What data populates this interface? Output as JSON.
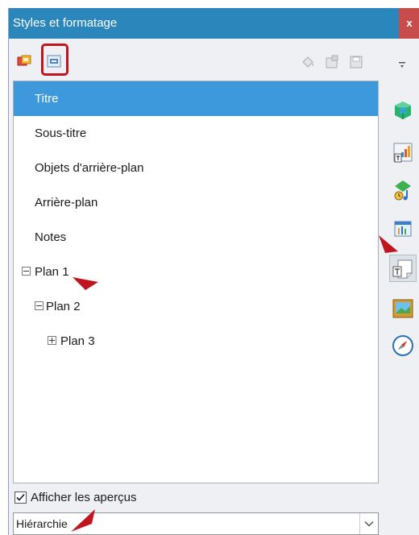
{
  "window": {
    "title": "Styles et formatage",
    "close_label": "x"
  },
  "toolbar": {
    "left_icons": [
      "graphic-styles-icon",
      "presentation-styles-icon"
    ],
    "right_icons": [
      "fill-format-mode-icon",
      "new-style-from-selection-icon",
      "update-style-icon"
    ]
  },
  "styles_list": {
    "items": [
      {
        "label": "Titre",
        "selected": true
      },
      {
        "label": "Sous-titre"
      },
      {
        "label": "Objets d'arrière-plan"
      },
      {
        "label": "Arrière-plan"
      },
      {
        "label": "Notes"
      },
      {
        "label": "Plan 1",
        "expander": "minus"
      },
      {
        "label": "Plan 2",
        "expander": "minus"
      },
      {
        "label": "Plan 3",
        "expander": "plus"
      }
    ]
  },
  "preview": {
    "label": "Afficher les aperçus",
    "checked": true
  },
  "filter": {
    "value": "Hiérarchie"
  },
  "sidebar": {
    "icons": [
      "menu-icon",
      "properties-icon",
      "styles-icon",
      "gallery-icon",
      "slide-transition-icon",
      "master-slides-icon",
      "animation-icon",
      "navigator-icon"
    ]
  },
  "colors": {
    "titlebar": "#2a86bb",
    "selection": "#3d98dc",
    "highlight": "#c0151f",
    "close": "#c74d4d"
  }
}
